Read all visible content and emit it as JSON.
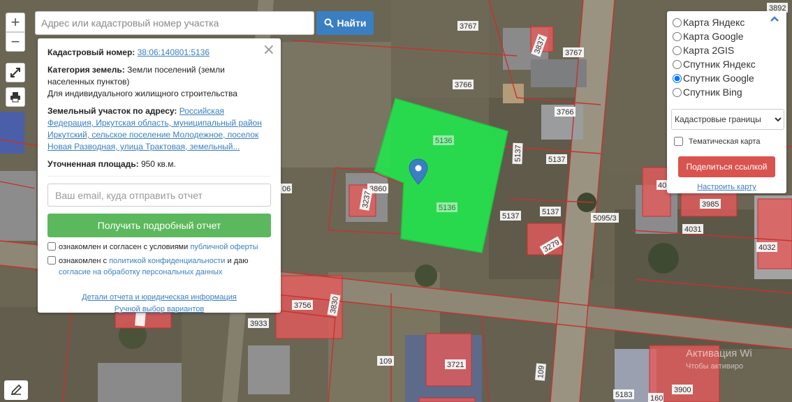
{
  "search": {
    "placeholder": "Адрес или кадастровый номер участка",
    "button_label": "Найти"
  },
  "zoom": {
    "in_label": "+",
    "out_label": "−"
  },
  "info": {
    "cadastral_label": "Кадастровый номер:",
    "cadastral_number": "38:06:140801:5136",
    "category_label": "Категория земель:",
    "category_value": "Земли поселений (земли населенных пунктов)",
    "use_value": "Для индивидуального жилищного строительства",
    "address_label": "Земельный участок по адресу:",
    "address_value": "Российская Федерация, Иркутская область, муниципальный район Иркутский, сельское поселение Молодежное, поселок Новая Разводная, улица Трактовая, земельный...",
    "area_label": "Уточненная площадь:",
    "area_value": "950 кв.м.",
    "email_placeholder": "Ваш email, куда отправить отчет",
    "report_button": "Получить подробный отчет",
    "consent1_prefix": "ознакомлен и согласен с условиями",
    "consent1_link": "публичной оферты",
    "consent2_prefix": "ознакомлен с",
    "consent2_link": "политикой конфиденциальности",
    "consent2_middle": "и даю",
    "consent2_link2": "согласие на обработку персональных данных",
    "details_link": "Детали отчета и юридическая информация",
    "manual_link": "Ручной выбор вариантов"
  },
  "layers": {
    "options": [
      {
        "label": "Карта Яндекс",
        "checked": false
      },
      {
        "label": "Карта Google",
        "checked": false
      },
      {
        "label": "Карта 2GIS",
        "checked": false
      },
      {
        "label": "Спутник Яндекс",
        "checked": false
      },
      {
        "label": "Спутник Google",
        "checked": true
      },
      {
        "label": "Спутник Bing",
        "checked": false
      }
    ],
    "select_value": "Кадастровые границы",
    "thematic_label": "Тематическая карта",
    "share_button": "Поделиться ссылкой",
    "configure_link": "Настроить карту"
  },
  "map_labels": {
    "parcel_top": "5136",
    "parcel_bottom": "5136",
    "l3767a": "3767",
    "l3767b": "3767",
    "l3766a": "3766",
    "l3766b": "3766",
    "l5137a": "5137",
    "l5137b": "5137",
    "l5137c": "5137",
    "l5137d": "5137",
    "l50953": "5095/3",
    "l3985": "3985",
    "l4031": "4031",
    "l4032": "4032",
    "l3279": "3279",
    "l3860": "3860",
    "l3237": "3237",
    "l06": "06",
    "l3756": "3756",
    "l3830": "3830",
    "l3933": "3933",
    "l109a": "109",
    "l109b": "109",
    "l3721": "3721",
    "l5183": "5183",
    "l160": "160",
    "l3900": "3900",
    "l3892": "3892",
    "l3837": "3837",
    "l40": "40"
  },
  "watermark": {
    "line1": "Активация Wi",
    "line2": "Чтобы активиро"
  },
  "colors": {
    "parcel_fill": "#22e64c",
    "building_red": "#e35a5a",
    "boundary": "#c4332f",
    "accent_blue": "#3a7fc1",
    "report_green": "#5cb85c",
    "share_red": "#d9534f"
  }
}
